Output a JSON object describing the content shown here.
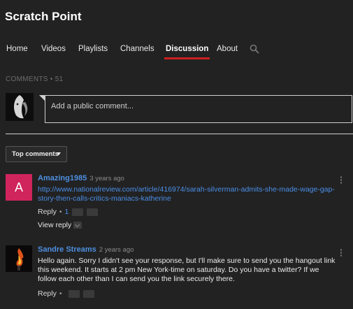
{
  "channel": {
    "title": "Scratch Point"
  },
  "nav": {
    "tabs": [
      {
        "label": "Home"
      },
      {
        "label": "Videos"
      },
      {
        "label": "Playlists"
      },
      {
        "label": "Channels"
      },
      {
        "label": "Discussion",
        "active": true
      },
      {
        "label": "About"
      }
    ],
    "search_icon": "search-icon"
  },
  "discussion": {
    "comments_label": "COMMENTS • 51",
    "input_placeholder": "Add a public comment...",
    "sort_label": "Top comments"
  },
  "comments": [
    {
      "avatar_letter": "A",
      "avatar_color": "#d0245c",
      "author": "Amazing1985",
      "time": "3 years ago",
      "text": "http://www.nationalreview.com/article/416974/sarah-silverman-admits-she-made-wage-gap-story-then-calls-critics-maniacs-katherine",
      "reply_label": "Reply",
      "separator": "•",
      "likes": "1",
      "view_reply_label": "View reply"
    },
    {
      "author": "Sandre Streams",
      "time": "2 years ago",
      "text": "Hello again. Sorry I didn't see your response, but I'll make sure to send you the hangout link this weekend. It starts at 2 pm New York-time on saturday. Do you have a twitter? If we follow each other than I can send you the link securely there.",
      "reply_label": "Reply",
      "separator": "•"
    }
  ],
  "colors": {
    "background": "#222222",
    "accent_red": "#cc1f1f",
    "link_blue": "#4a8ee8",
    "author_blue": "#4d8fe0"
  }
}
